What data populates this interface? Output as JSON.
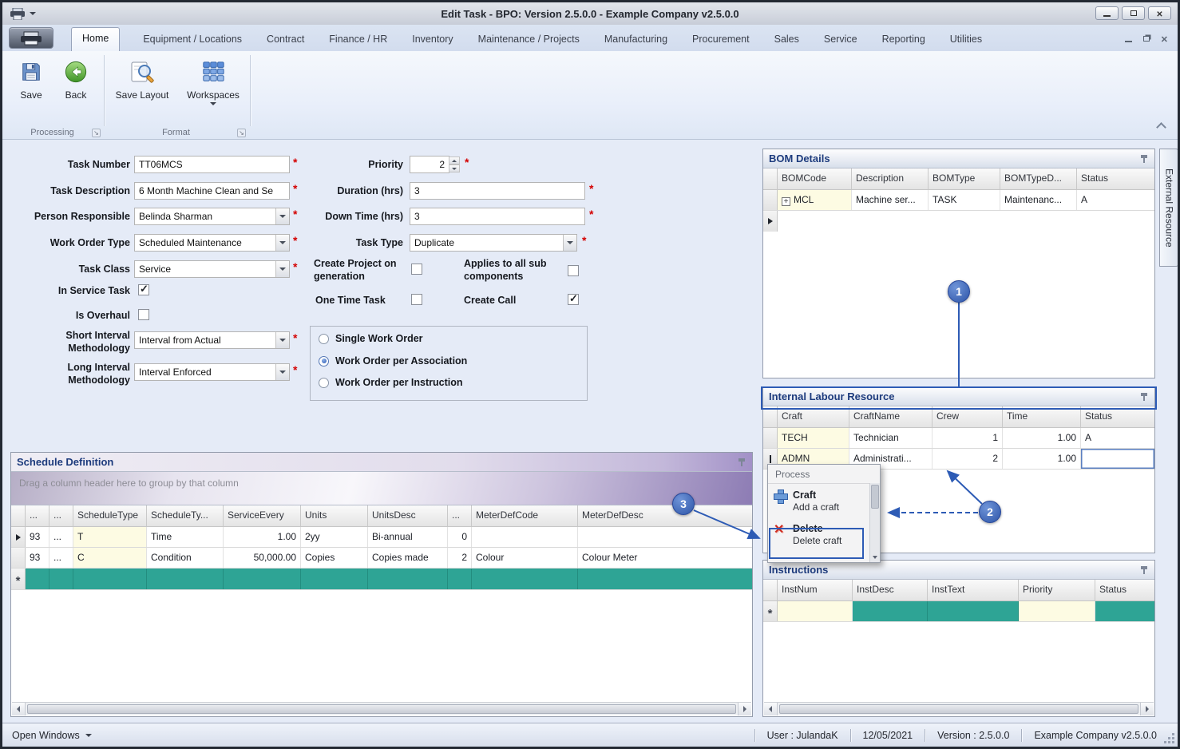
{
  "window": {
    "title": "Edit Task - BPO: Version 2.5.0.0 - Example Company v2.5.0.0"
  },
  "ribbon": {
    "tabs": [
      "Home",
      "Equipment / Locations",
      "Contract",
      "Finance / HR",
      "Inventory",
      "Maintenance / Projects",
      "Manufacturing",
      "Procurement",
      "Sales",
      "Service",
      "Reporting",
      "Utilities"
    ],
    "buttons": {
      "save": "Save",
      "back": "Back",
      "save_layout": "Save Layout",
      "workspaces": "Workspaces"
    },
    "groups": {
      "processing": "Processing",
      "format": "Format"
    }
  },
  "form": {
    "task_number": {
      "label": "Task Number",
      "value": "TT06MCS"
    },
    "task_description": {
      "label": "Task Description",
      "value": "6 Month Machine Clean and Se"
    },
    "person_responsible": {
      "label": "Person Responsible",
      "value": "Belinda Sharman"
    },
    "work_order_type": {
      "label": "Work Order Type",
      "value": "Scheduled Maintenance"
    },
    "task_class": {
      "label": "Task Class",
      "value": "Service"
    },
    "in_service_task": {
      "label": "In Service Task",
      "checked": true
    },
    "is_overhaul": {
      "label": "Is Overhaul",
      "checked": false
    },
    "short_interval": {
      "label": "Short Interval Methodology",
      "value": "Interval from Actual"
    },
    "long_interval": {
      "label": "Long Interval Methodology",
      "value": "Interval Enforced"
    },
    "priority": {
      "label": "Priority",
      "value": "2"
    },
    "duration": {
      "label": "Duration (hrs)",
      "value": "3"
    },
    "down_time": {
      "label": "Down Time (hrs)",
      "value": "3"
    },
    "task_type": {
      "label": "Task Type",
      "value": "Duplicate"
    },
    "create_project": {
      "label": "Create Project on generation",
      "checked": false
    },
    "applies_sub": {
      "label": "Applies to all sub components",
      "checked": false
    },
    "one_time_task": {
      "label": "One Time Task",
      "checked": false
    },
    "create_call": {
      "label": "Create Call",
      "checked": true
    },
    "work_order_options": [
      {
        "label": "Single Work Order",
        "selected": false
      },
      {
        "label": "Work Order per Association",
        "selected": true
      },
      {
        "label": "Work Order per Instruction",
        "selected": false
      }
    ]
  },
  "bom": {
    "title": "BOM Details",
    "columns": [
      "BOMCode",
      "Description",
      "BOMType",
      "BOMTypeD...",
      "Status"
    ],
    "rows": [
      [
        "MCL",
        "Machine ser...",
        "TASK",
        "Maintenanc...",
        "A"
      ]
    ]
  },
  "labour": {
    "title": "Internal Labour Resource",
    "columns": [
      "Craft",
      "CraftName",
      "Crew",
      "Time",
      "Status"
    ],
    "rows": [
      [
        "TECH",
        "Technician",
        "1",
        "1.00",
        "A"
      ],
      [
        "ADMN",
        "Administrati...",
        "2",
        "1.00",
        ""
      ]
    ]
  },
  "menu": {
    "header": "Process",
    "items": [
      {
        "title": "Craft",
        "subtitle": "Add a craft"
      },
      {
        "title": "Delete",
        "subtitle": "Delete craft"
      }
    ]
  },
  "schedule": {
    "title": "Schedule Definition",
    "group_hint": "Drag a column header here to group by that column",
    "columns": [
      "...",
      "...",
      "ScheduleType",
      "ScheduleTy...",
      "ServiceEvery",
      "Units",
      "UnitsDesc",
      "...",
      "MeterDefCode",
      "MeterDefDesc"
    ],
    "rows": [
      [
        "93",
        "...",
        "T",
        "Time",
        "1.00",
        "2yy",
        "Bi-annual",
        "0",
        "",
        ""
      ],
      [
        "93",
        "...",
        "C",
        "Condition",
        "50,000.00",
        "Copies",
        "Copies made",
        "2",
        "Colour",
        "Colour Meter"
      ]
    ]
  },
  "instructions": {
    "title": "Instructions",
    "columns": [
      "InstNum",
      "InstDesc",
      "InstText",
      "Priority",
      "Status"
    ]
  },
  "external_tab": "External Resource",
  "statusbar": {
    "open_windows": "Open Windows",
    "user": "User : JulandaK",
    "date": "12/05/2021",
    "version": "Version : 2.5.0.0",
    "company": "Example Company v2.5.0.0"
  },
  "callouts": {
    "c1": "1",
    "c2": "2",
    "c3": "3"
  }
}
